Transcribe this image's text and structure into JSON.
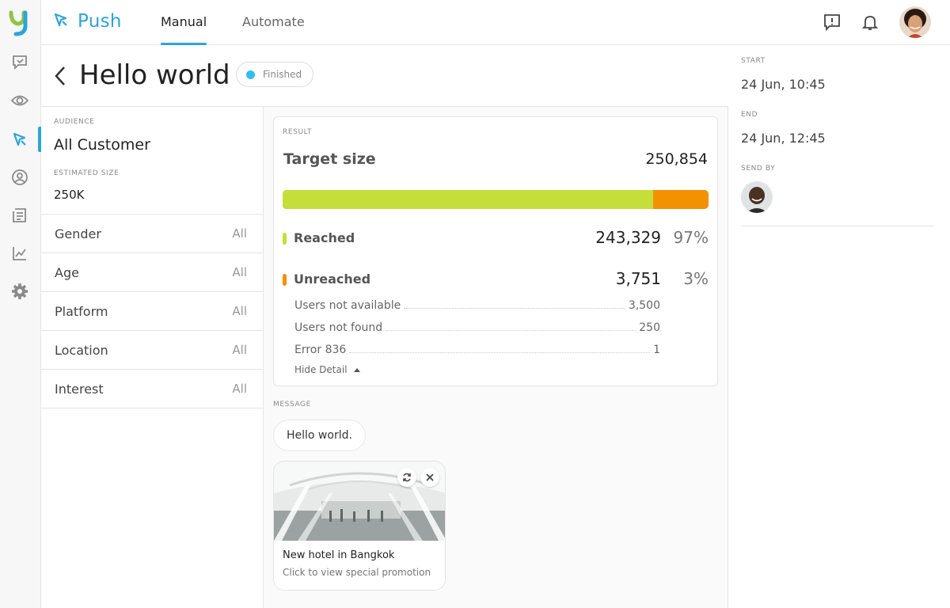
{
  "nav": {
    "brand": "Push",
    "tabs": [
      {
        "label": "Manual"
      },
      {
        "label": "Automate"
      }
    ],
    "active_tab": "Manual"
  },
  "sidebar": {
    "icons": [
      "logo-icon",
      "chat-icon",
      "eye-icon",
      "push-icon",
      "user-icon",
      "report-icon",
      "chart-icon",
      "gear-icon"
    ],
    "active": "push-icon"
  },
  "header": {
    "title": "Hello world",
    "status": "Finished",
    "status_color": "#2fbdf5"
  },
  "audience": {
    "label": "AUDIENCE",
    "value": "All Customer",
    "est_label": "ESTIMATED SIZE",
    "est_value": "250K",
    "filters": [
      {
        "name": "Gender",
        "value": "All"
      },
      {
        "name": "Age",
        "value": "All"
      },
      {
        "name": "Platform",
        "value": "All"
      },
      {
        "name": "Location",
        "value": "All"
      },
      {
        "name": "Interest",
        "value": "All"
      }
    ]
  },
  "result": {
    "label": "RESULT",
    "target_label": "Target size",
    "target_value": "250,854",
    "reached_fraction": 0.87,
    "reached": {
      "label": "Reached",
      "count": "243,329",
      "pct": "97%",
      "color": "#c6de3a"
    },
    "unreached": {
      "label": "Unreached",
      "count": "3,751",
      "pct": "3%",
      "color": "#f39200"
    },
    "details": [
      {
        "label": "Users not available",
        "value": "3,500"
      },
      {
        "label": "Users not found",
        "value": "250"
      },
      {
        "label": "Error 836",
        "value": "1"
      }
    ],
    "hide_detail": "Hide Detail"
  },
  "message": {
    "label": "MESSAGE",
    "text": "Hello world.",
    "card_title": "New hotel in Bangkok",
    "card_subtitle": "Click to view special promotion"
  },
  "schedule": {
    "start_label": "START",
    "start_value": "24 Jun, 10:45",
    "end_label": "END",
    "end_value": "24 Jun, 12:45",
    "send_by_label": "SEND BY"
  },
  "colors": {
    "accent": "#2aa4dd",
    "reached": "#c6de3a",
    "unreached": "#f39200"
  }
}
